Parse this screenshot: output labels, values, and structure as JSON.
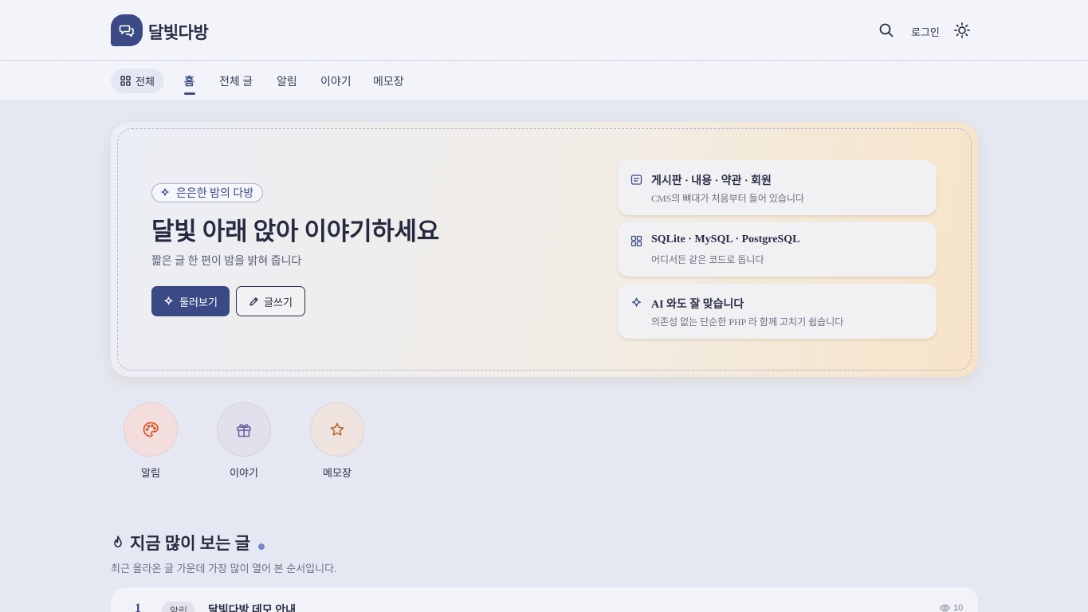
{
  "site": {
    "name": "달빛다방"
  },
  "header": {
    "login_label": "로그인"
  },
  "nav": {
    "all_label": "전체",
    "items": [
      {
        "label": "홈",
        "active": true
      },
      {
        "label": "전체 글"
      },
      {
        "label": "알림"
      },
      {
        "label": "이야기"
      },
      {
        "label": "메모장"
      }
    ]
  },
  "hero": {
    "tag": "은은한 밤의 다방",
    "title": "달빛 아래 앉아 이야기하세요",
    "subtitle": "짧은 글 한 편이 밤을 밝혀 줍니다",
    "primary_button": "둘러보기",
    "secondary_button": "글쓰기",
    "features": [
      {
        "icon": "board-icon",
        "title": "게시판 · 내용 · 약관 · 회원",
        "desc": "CMS의 뼈대가 처음부터 들어 있습니다"
      },
      {
        "icon": "grid-icon",
        "title": "SQLite · MySQL · PostgreSQL",
        "desc": "어디서든 같은 코드로 돕니다"
      },
      {
        "icon": "sparkle-icon",
        "title": "AI 와도 잘 맞습니다",
        "desc": "의존성 없는 단순한 PHP 라 함께 고치기 쉽습니다"
      }
    ]
  },
  "categories": [
    {
      "label": "알림",
      "icon": "palette-icon",
      "color": "#d9582f",
      "bg": "#f3dedd"
    },
    {
      "label": "이야기",
      "icon": "gift-icon",
      "color": "#6a5fa0",
      "bg": "#e3e0ee"
    },
    {
      "label": "메모장",
      "icon": "star-icon",
      "color": "#b86a2a",
      "bg": "#eee3df"
    }
  ],
  "popular": {
    "title": "지금 많이 보는 글",
    "subtitle": "최근 올라온 글 가운데 가장 많이 열어 본 순서입니다.",
    "rows": [
      {
        "rank": "1",
        "badge": "알림",
        "title": "달빛다방 데모 안내",
        "views": "10"
      }
    ]
  },
  "colors": {
    "accent": "#3b4a85",
    "background": "#e5e8f2"
  }
}
